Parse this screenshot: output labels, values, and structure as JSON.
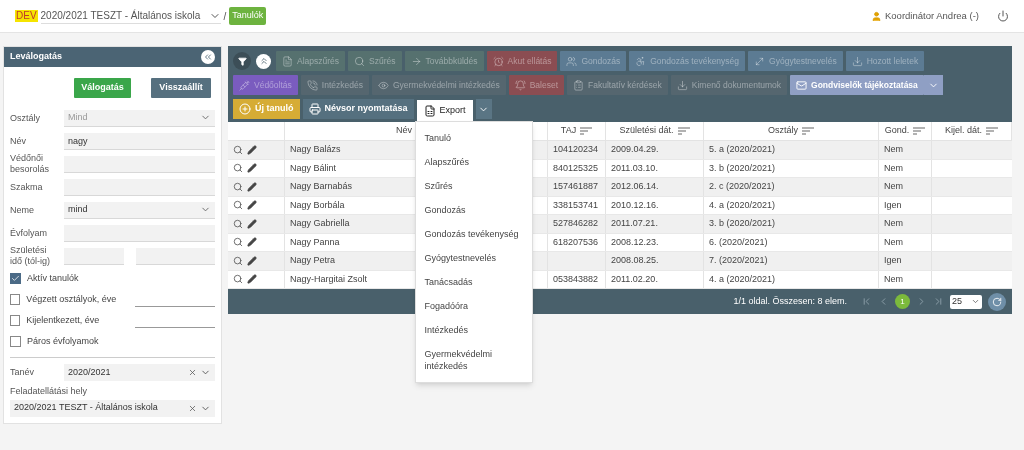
{
  "header": {
    "env_badge": "DEV",
    "school_select": "2020/2021 TESZT - Általános iskola",
    "separator": "/",
    "page_badge": "Tanulók",
    "user": "Koordinátor Andrea (-)"
  },
  "filter_panel": {
    "title": "Leválogatás",
    "buttons": [
      {
        "label": "Válogatás",
        "kind": "primary"
      },
      {
        "label": "Visszaállít",
        "kind": "secondary"
      }
    ],
    "fields": [
      {
        "label": "Osztály",
        "kind": "select",
        "placeholder": "Mind"
      },
      {
        "label": "Név",
        "kind": "input",
        "value": "nagy"
      },
      {
        "label": "Védőnői besorolás",
        "kind": "input"
      },
      {
        "label": "Szakma",
        "kind": "input"
      },
      {
        "label": "Neme",
        "kind": "select",
        "value": "mind"
      },
      {
        "label": "Évfolyam",
        "kind": "input"
      },
      {
        "label": "Születési idő (tól-ig)",
        "kind": "range"
      }
    ],
    "checks": [
      {
        "label": "Aktív tanulók",
        "checked": true,
        "kind": "plain"
      },
      {
        "label": "Végzett osztályok, éve",
        "checked": false,
        "kind": "with_year"
      },
      {
        "label": "Kijelentkezett, éve",
        "checked": false,
        "kind": "with_year"
      },
      {
        "label": "Páros évfolyamok",
        "checked": false,
        "kind": "plain"
      }
    ],
    "tanev": {
      "label": "Tanév",
      "value": "2020/2021"
    },
    "hely": {
      "label": "Feladatellátási hely",
      "value": "2020/2021 TESZT - Általános iskola"
    }
  },
  "toolbar": {
    "rows": [
      [
        {
          "label": "Alapszűrés",
          "color": "#56716f",
          "disabled": true
        },
        {
          "label": "Szűrés",
          "color": "#56716f",
          "disabled": true
        },
        {
          "label": "Továbbküldés",
          "color": "#56716f",
          "disabled": true
        },
        {
          "label": "Akut ellátás",
          "color": "#8b4d52",
          "disabled": true
        },
        {
          "label": "Gondozás",
          "color": "#5c7b93",
          "disabled": true
        },
        {
          "label": "Gondozás tevékenység",
          "color": "#5c7b93",
          "disabled": true
        },
        {
          "label": "Gyógytestnevelés",
          "color": "#5c7b93",
          "disabled": true
        },
        {
          "label": "Hozott leletek",
          "color": "#5c7b93",
          "disabled": true
        }
      ],
      [
        {
          "label": "Védőoltás",
          "color": "#7a5cbf",
          "disabled": true
        },
        {
          "label": "Intézkedés",
          "color": "#55666f",
          "disabled": true
        },
        {
          "label": "Gyermekvédelmi intézkedés",
          "color": "#55666f",
          "disabled": true
        },
        {
          "label": "Baleset",
          "color": "#8b4d52",
          "disabled": true
        },
        {
          "label": "Fakultatív kérdések",
          "color": "#55666f",
          "disabled": true
        },
        {
          "label": "Kimenő dokumentumok",
          "color": "#55666f",
          "disabled": true
        },
        {
          "label": "Gondviselők tájékoztatása",
          "color": "#8f9fc4",
          "disabled": false
        }
      ]
    ],
    "actions": [
      {
        "label": "Új tanuló",
        "color": "#d6ac35"
      },
      {
        "label": "Névsor nyomtatása",
        "color": "#55707f"
      }
    ],
    "export": {
      "label": "Export",
      "expanded": true
    }
  },
  "export_menu": [
    "Tanuló",
    "Alapszűrés",
    "Szűrés",
    "Gondozás",
    "Gondozás tevékenység",
    "Gyógytestnevelés",
    "Tanácsadás",
    "Fogadóóra",
    "Intézkedés",
    "Gyermekvédelmi intézkedés"
  ],
  "table": {
    "columns": [
      {
        "label": "Név",
        "sort_icon": false
      },
      {
        "label": "TAJ",
        "sort_icon": true
      },
      {
        "label": "Születési dát.",
        "sort_icon": true
      },
      {
        "label": "Osztály",
        "sort_icon": true
      },
      {
        "label": "Gond.",
        "sort_icon": true
      },
      {
        "label": "Kijel. dát.",
        "sort_icon": true
      }
    ],
    "rows": [
      {
        "name": "Nagy Balázs",
        "taj": "104120234",
        "birth": "2009.04.29.",
        "class": "5. a (2020/2021)",
        "gond": "Nem"
      },
      {
        "name": "Nagy Bálint",
        "taj": "840125325",
        "birth": "2011.03.10.",
        "class": "3. b (2020/2021)",
        "gond": "Nem"
      },
      {
        "name": "Nagy Barnabás",
        "taj": "157461887",
        "birth": "2012.06.14.",
        "class": "2. c (2020/2021)",
        "gond": "Nem"
      },
      {
        "name": "Nagy Borbála",
        "taj": "338153741",
        "birth": "2010.12.16.",
        "class": "4. a (2020/2021)",
        "gond": "Igen"
      },
      {
        "name": "Nagy Gabriella",
        "taj": "527846282",
        "birth": "2011.07.21.",
        "class": "3. b (2020/2021)",
        "gond": "Nem"
      },
      {
        "name": "Nagy Panna",
        "taj": "618207536",
        "birth": "2008.12.23.",
        "class": "6. (2020/2021)",
        "gond": "Nem"
      },
      {
        "name": "Nagy Petra",
        "birth": "2008.08.25.",
        "class": "7. (2020/2021)",
        "gond": "Igen"
      },
      {
        "name": "Nagy-Hargitai Zsolt",
        "taj": "053843882",
        "birth": "2011.02.20.",
        "class": "4. a (2020/2021)",
        "gond": "Nem"
      }
    ]
  },
  "pagination": {
    "summary": "1/1 oldal. Összesen: 8 elem.",
    "pages": [
      {
        "label": "1",
        "selected": true
      }
    ],
    "page_size": "25"
  }
}
